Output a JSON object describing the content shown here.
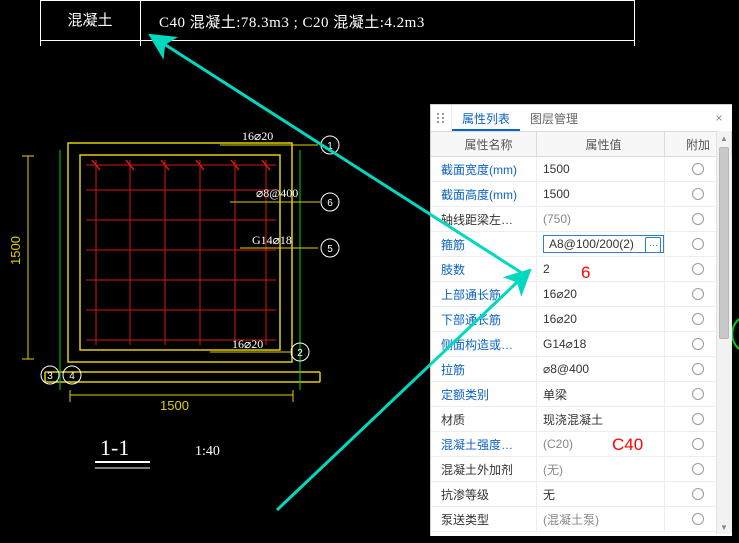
{
  "top_table": {
    "row_label": "混凝土",
    "row_value": "C40 混凝土:78.3m3 ; C20 混凝土:4.2m3"
  },
  "drawing": {
    "dim_top_text": "16⌀20",
    "rebar_text_1": "⌀8@400",
    "rebar_text_2": "G14⌀18",
    "dim_bottom_text": "16⌀20",
    "dim_width": "1500",
    "dim_height": "1500",
    "section_label": "1-1",
    "scale_label": "1:40",
    "bubbles": [
      "1",
      "6",
      "5",
      "2",
      "3",
      "4"
    ]
  },
  "panel": {
    "tabs": {
      "active": "属性列表",
      "inactive": "图层管理"
    },
    "close_glyph": "×",
    "head": {
      "name": "属性名称",
      "value": "属性值",
      "extra": "附加"
    },
    "rows": [
      {
        "name": "截面宽度(mm)",
        "value": "1500",
        "blue": true
      },
      {
        "name": "截面高度(mm)",
        "value": "1500",
        "blue": true
      },
      {
        "name": "轴线距梁左…",
        "value": "(750)",
        "paren": true
      },
      {
        "name": "箍筋",
        "value": "A8@100/200(2)",
        "blue": true,
        "editing": true
      },
      {
        "name": "肢数",
        "value": "2",
        "blue": true
      },
      {
        "name": "上部通长筋",
        "value": "16⌀20",
        "blue": true
      },
      {
        "name": "下部通长筋",
        "value": "16⌀20",
        "blue": true
      },
      {
        "name": "侧面构造或…",
        "value": "G14⌀18",
        "blue": true
      },
      {
        "name": "拉筋",
        "value": "⌀8@400",
        "blue": true
      },
      {
        "name": "定额类别",
        "value": "单梁",
        "blue": true
      },
      {
        "name": "材质",
        "value": "现浇混凝土"
      },
      {
        "name": "混凝土强度…",
        "value": "(C20)",
        "blue": true,
        "paren": true
      },
      {
        "name": "混凝土外加剂",
        "value": "(无)",
        "paren": true
      },
      {
        "name": "抗渗等级",
        "value": "无"
      },
      {
        "name": "泵送类型",
        "value": "(混凝土泵)",
        "paren": true
      }
    ]
  },
  "annotations": {
    "red_6": "6",
    "red_c40": "C40"
  },
  "colors": {
    "link_blue": "#0b62c4",
    "arrow_teal": "#00d8c0",
    "red": "#ff0000",
    "rebar_red": "#e02020",
    "outline_yellow": "#e0d000",
    "green": "#00d020"
  }
}
